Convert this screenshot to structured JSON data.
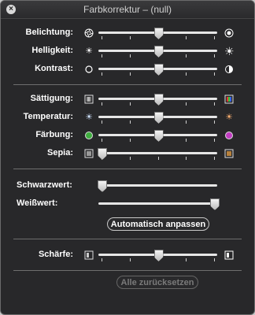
{
  "window": {
    "title": "Farbkorrektur – (null)"
  },
  "section_exposure": {
    "rows": [
      {
        "label": "Belichtung:",
        "left_icon": "aperture-closed-icon",
        "right_icon": "aperture-open-icon",
        "value": 0.5
      },
      {
        "label": "Helligkeit:",
        "left_icon": "sun-small-icon",
        "right_icon": "sun-large-icon",
        "value": 0.5
      },
      {
        "label": "Kontrast:",
        "left_icon": "circle-filled-icon",
        "right_icon": "circle-half-icon",
        "value": 0.5
      }
    ]
  },
  "section_color": {
    "rows": [
      {
        "label": "Sättigung:",
        "left_icon": "gray-swatch-icon",
        "right_icon": "color-swatch-icon",
        "value": 0.5
      },
      {
        "label": "Temperatur:",
        "left_icon": "sun-cool-icon",
        "right_icon": "sun-warm-icon",
        "value": 0.5
      },
      {
        "label": "Färbung:",
        "left_icon": "green-dot-icon",
        "right_icon": "magenta-dot-icon",
        "value": 0.5
      },
      {
        "label": "Sepia:",
        "left_icon": "gray-swatch-icon",
        "right_icon": "sepia-swatch-icon",
        "value": 0.0
      }
    ]
  },
  "section_levels": {
    "rows": [
      {
        "label": "Schwarzwert:",
        "value": 0.0
      },
      {
        "label": "Weißwert:",
        "value": 1.0
      }
    ],
    "auto_button": "Automatisch anpassen"
  },
  "section_sharpness": {
    "rows": [
      {
        "label": "Schärfe:",
        "left_icon": "blurry-icon",
        "right_icon": "sharp-icon",
        "value": 0.5
      }
    ]
  },
  "reset_button": "Alle zurücksetzen",
  "colors": {
    "panel_bg": "#1c1c1e",
    "track": "#e6e6e6",
    "divider": "#6e6e6e"
  }
}
